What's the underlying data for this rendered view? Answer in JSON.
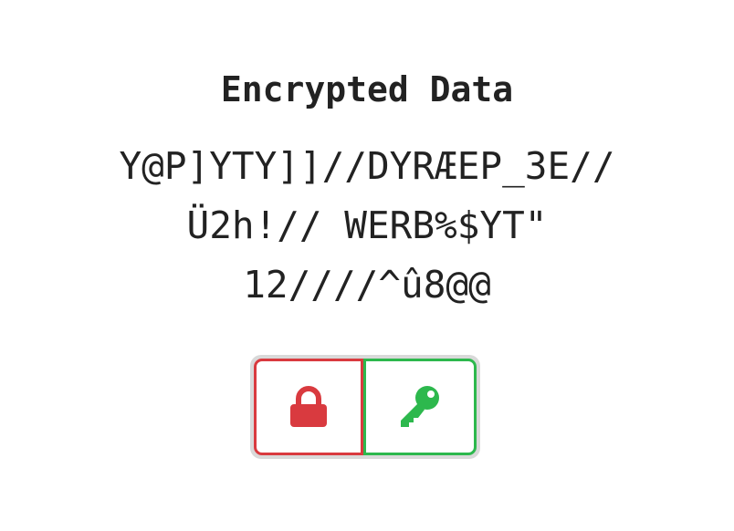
{
  "header": {
    "title": "Encrypted Data"
  },
  "cipher": {
    "lines": [
      "Y@P]YTY]]//DYRÆEP_3E//",
      "Ü2h!// WERB%$YT\"",
      "12////^û8@@"
    ]
  },
  "actions": {
    "lock": {
      "icon": "lock-icon",
      "color": "#d93a3f"
    },
    "key": {
      "icon": "key-icon",
      "color": "#2db84d"
    }
  }
}
